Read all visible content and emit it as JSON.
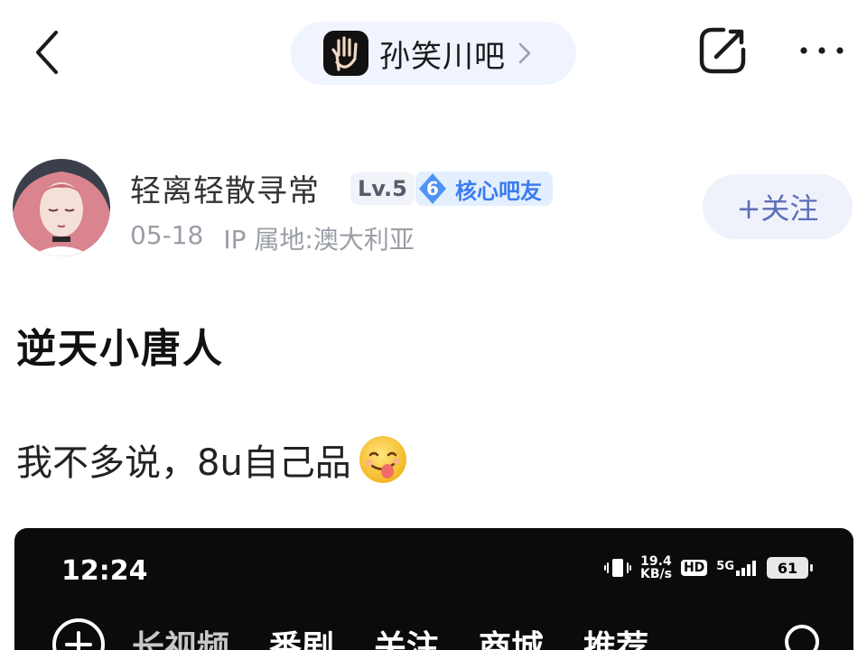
{
  "topbar": {
    "forum_name": "孙笑川吧",
    "back_icon": "back-chevron-icon",
    "share_icon": "share-icon",
    "more_icon": "more-dots-icon"
  },
  "author": {
    "name": "轻离轻散寻常",
    "level": "Lv.5",
    "core_rank": "6",
    "core_label": "核心吧友",
    "date": "05-18",
    "ip_location": "IP 属地:澳大利亚",
    "follow_label": "+关注"
  },
  "post": {
    "title": "逆天小唐人",
    "body": "我不多说，8u自己品"
  },
  "embed": {
    "time": "12:24",
    "speed_value": "19.4",
    "speed_unit": "KB/s",
    "hd": "HD",
    "network": "5G",
    "battery": "61",
    "tabs": [
      "长视频",
      "番剧",
      "关注",
      "商城",
      "推荐"
    ]
  },
  "colors": {
    "forum_pill_bg": "#eff4ff",
    "follow_bg": "#eff2fb",
    "follow_text": "#5e6fb8",
    "core_badge_bg": "#e3efff",
    "core_badge_text": "#3b7cf0",
    "embed_bg": "#0b0b0b"
  }
}
